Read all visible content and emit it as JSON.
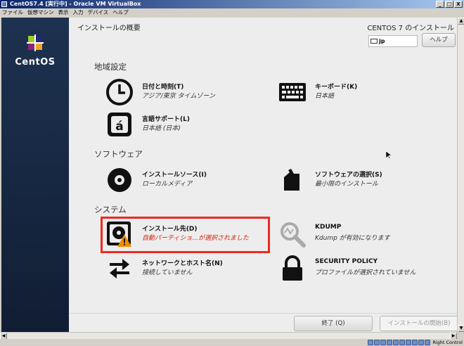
{
  "window": {
    "title": "CentOS7.4 [実行中] - Oracle VM VirtualBox",
    "minimize": "_",
    "maximize": "□",
    "close": "X"
  },
  "menu": [
    "ファイル",
    "仮想マシン",
    "表示",
    "入力",
    "デバイス",
    "ヘルプ"
  ],
  "sidebar": {
    "logo_text": "CentOS"
  },
  "header": {
    "title": "インストールの概要",
    "right": "CENTOS 7 のインストール",
    "keyboard_layout": "jp",
    "help": "ヘルプ"
  },
  "sections": {
    "localization": "地域設定",
    "software": "ソフトウェア",
    "system": "システム"
  },
  "spokes": {
    "datetime": {
      "title": "日付と時刻(T)",
      "status": "アジア/東京 タイムゾーン"
    },
    "keyboard": {
      "title": "キーボード(K)",
      "status": "日本語"
    },
    "language": {
      "title": "言語サポート(L)",
      "status": "日本語 (日本)"
    },
    "source": {
      "title": "インストールソース(I)",
      "status": "ローカルメディア"
    },
    "software_selection": {
      "title": "ソフトウェアの選択(S)",
      "status": "最小限のインストール"
    },
    "destination": {
      "title": "インストール先(D)",
      "status": "自動パーティショ...が選択されました"
    },
    "kdump": {
      "title": "KDUMP",
      "status": "Kdump が有効になります"
    },
    "network": {
      "title": "ネットワークとホスト名(N)",
      "status": "接続していません"
    },
    "security": {
      "title": "SECURITY POLICY",
      "status": "プロファイルが選択されていません"
    }
  },
  "footer": {
    "quit": "終了 (Q)",
    "begin": "インストールの開始(B)"
  },
  "statusbar": {
    "hostkey": "Right Control"
  },
  "colors": {
    "warning": "#d9220a",
    "highlight_border": "#ee2a1f",
    "sidebar": "#1d3250"
  }
}
